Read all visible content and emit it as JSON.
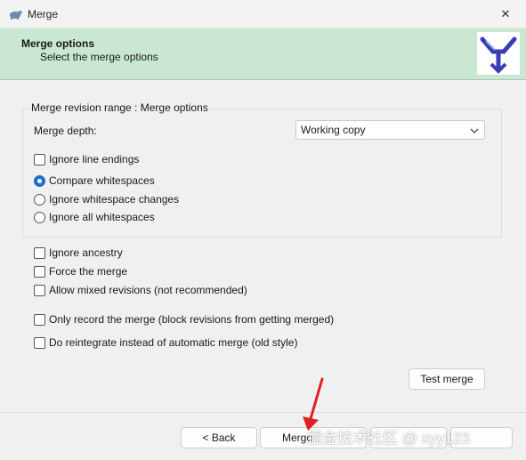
{
  "window": {
    "title": "Merge",
    "close_glyph": "✕"
  },
  "header": {
    "title": "Merge options",
    "subtitle": "Select the merge options"
  },
  "group": {
    "legend": "Merge revision range : Merge options",
    "depth_label": "Merge depth:",
    "depth_value": "Working copy"
  },
  "options": {
    "ignore_line_endings": "Ignore line endings",
    "compare_whitespaces": "Compare whitespaces",
    "ignore_ws_changes": "Ignore whitespace changes",
    "ignore_all_ws": "Ignore all whitespaces",
    "ignore_ancestry": "Ignore ancestry",
    "force_merge": "Force the merge",
    "allow_mixed": "Allow mixed revisions (not recommended)",
    "only_record": "Only record the merge (block revisions from getting merged)",
    "reintegrate": "Do reintegrate instead of automatic merge (old style)"
  },
  "state": {
    "whitespace_mode": "Compare whitespaces",
    "checked": []
  },
  "buttons": {
    "test_merge": "Test merge",
    "back": "< Back",
    "merge": "Merge"
  },
  "watermark": "掘金技术社区 @ xyy123",
  "colors": {
    "header_bg": "#c9e7d2",
    "accent": "#1a6fd0",
    "annotation_arrow": "#e02020"
  }
}
